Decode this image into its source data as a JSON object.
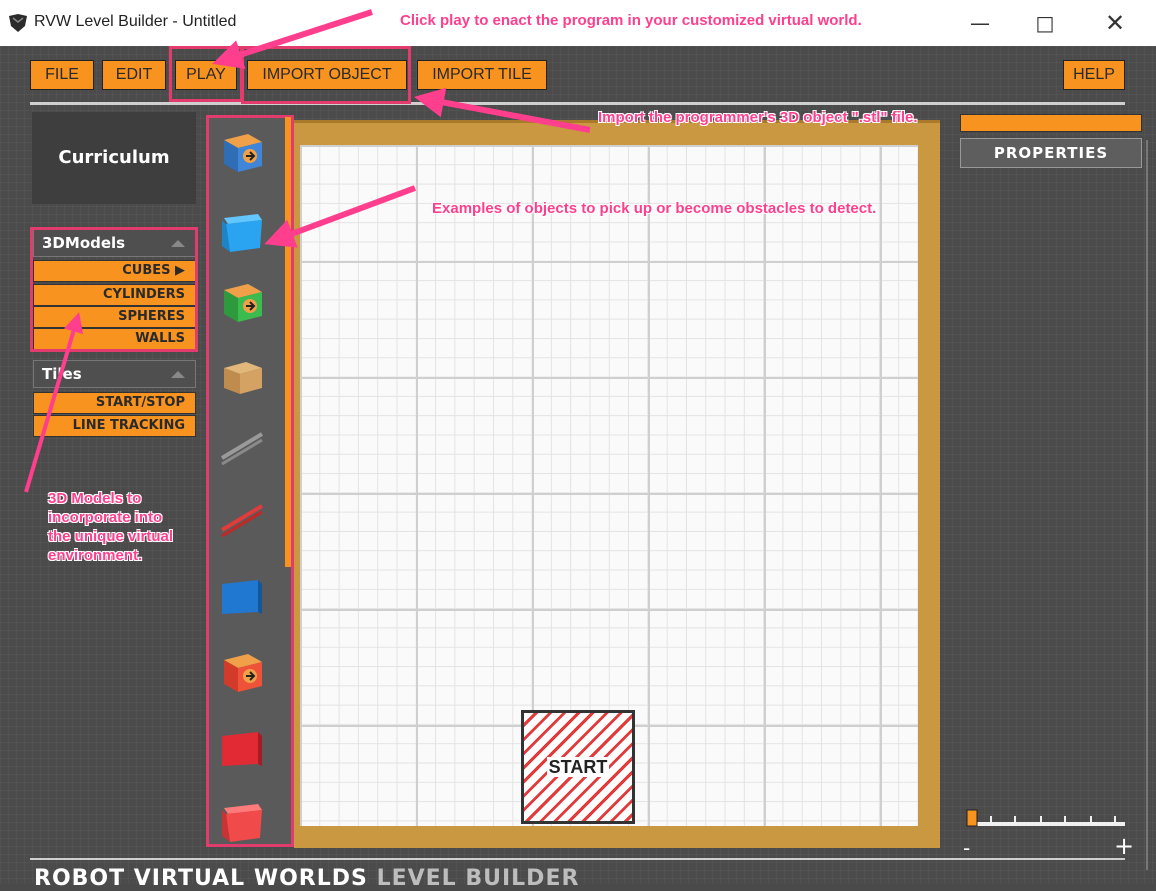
{
  "window": {
    "title": "RVW Level Builder - Untitled",
    "controls": {
      "minimize": "—",
      "maximize": "□",
      "close": "✕"
    }
  },
  "toolbar": {
    "file": "FILE",
    "edit": "EDIT",
    "play": "PLAY",
    "import_object": "IMPORT OBJECT",
    "import_tile": "IMPORT TILE",
    "help": "HELP"
  },
  "sidebar": {
    "curriculum": "Curriculum",
    "models": {
      "title": "3DModels",
      "items": [
        "CUBES ▶",
        "CYLINDERS",
        "SPHERES",
        "WALLS"
      ]
    },
    "tiles": {
      "title": "Tiles",
      "items": [
        "START/STOP",
        "LINE TRACKING"
      ]
    }
  },
  "objects": [
    "cube-icon",
    "bin-icon",
    "cube-icon",
    "box-icon",
    "rod-icon",
    "rod-icon",
    "wall-icon",
    "cube-icon",
    "wall-icon",
    "bin-icon"
  ],
  "board": {
    "start_label": "START"
  },
  "properties": {
    "label": "PROPERTIES"
  },
  "footer": {
    "brand": "ROBOT VIRTUAL WORLDS",
    "sub": "LEVEL BUILDER"
  },
  "zoom": {
    "minus": "-",
    "plus": "+",
    "level": 0
  },
  "annotations": {
    "play": "Click play to enact the program in your customized virtual world.",
    "import": "Import the programmer's 3D object \".stl\" file.",
    "examples": "Examples of objects to pick up or become obstacles to detect.",
    "models": "3D Models to incorporate into the unique virtual environment."
  },
  "colors": {
    "accent": "#f7931e",
    "annotation": "#ff3f8e",
    "highlight": "#e23b6d"
  }
}
